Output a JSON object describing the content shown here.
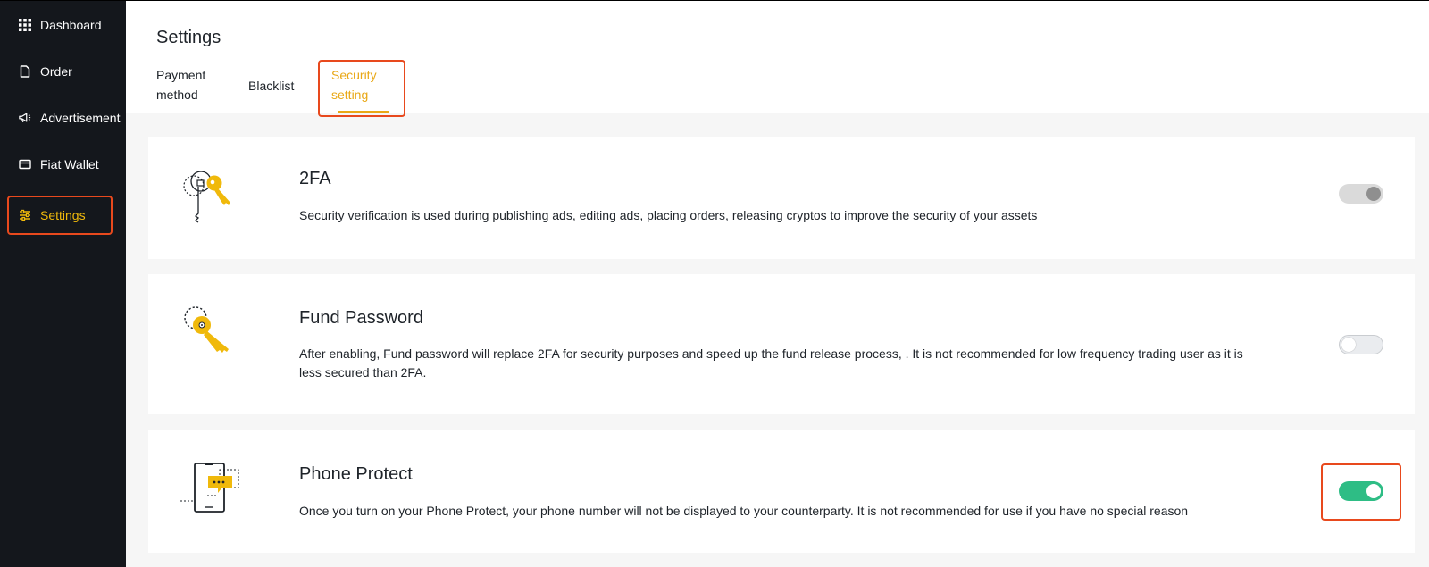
{
  "sidebar": {
    "items": [
      {
        "label": "Dashboard",
        "icon": "grid-icon"
      },
      {
        "label": "Order",
        "icon": "document-icon"
      },
      {
        "label": "Advertisement",
        "icon": "megaphone-icon"
      },
      {
        "label": "Fiat Wallet",
        "icon": "wallet-icon"
      },
      {
        "label": "Settings",
        "icon": "sliders-icon",
        "active": true
      }
    ]
  },
  "header": {
    "title": "Settings",
    "tabs": [
      {
        "label_line1": "Payment",
        "label_line2": "method"
      },
      {
        "label": "Blacklist"
      },
      {
        "label_line1": "Security",
        "label_line2": "setting",
        "active": true
      }
    ]
  },
  "security": {
    "items": [
      {
        "title": "2FA",
        "description": "Security verification is used during publishing ads, editing ads, placing orders, releasing cryptos to improve the security of your assets",
        "icon": "keys-icon",
        "toggle_state": "disabled"
      },
      {
        "title": "Fund Password",
        "description": "After enabling, Fund password will replace 2FA for security purposes and speed up the fund release process, . It is not recommended for low frequency trading user as it is less secured than 2FA.",
        "icon": "key-icon",
        "toggle_state": "off"
      },
      {
        "title": "Phone Protect",
        "description": "Once you turn on your Phone Protect, your phone number will not be displayed to your counterparty. It is not recommended for use if you have no special reason",
        "icon": "phone-icon",
        "toggle_state": "on"
      }
    ]
  },
  "colors": {
    "sidebar_bg": "#14171c",
    "accent": "#f0b90b",
    "tab_active": "#e9a816",
    "toggle_on": "#2ebd85",
    "highlight": "#e8491d"
  }
}
